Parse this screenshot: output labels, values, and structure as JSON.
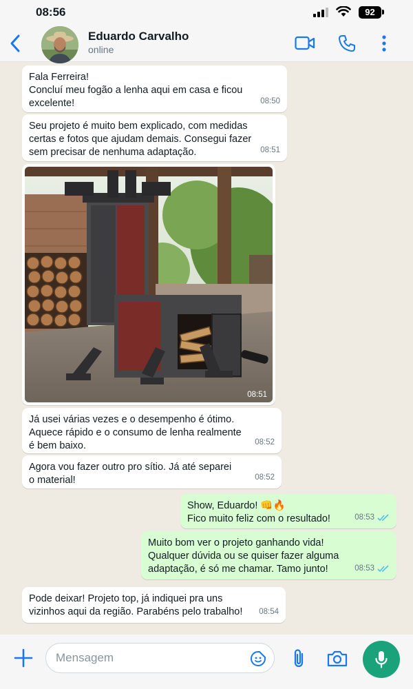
{
  "status_bar": {
    "time": "08:56",
    "battery": "92"
  },
  "header": {
    "contact_name": "Eduardo Carvalho",
    "contact_status": "online",
    "icons": [
      "back-arrow-icon",
      "video-call-icon",
      "phone-call-icon",
      "more-options-icon"
    ]
  },
  "messages": [
    {
      "direction": "in",
      "text": "Fala Ferreira!\nConcluí meu fogão a lenha aqui em casa e ficou\nexcelente!",
      "time": "08:50"
    },
    {
      "direction": "in",
      "text": "Seu projeto é muito bem explicado, com medidas\ncertas e fotos que ajudam demais. Consegui fazer\nsem precisar de nenhuma adaptação.",
      "time": "08:51"
    },
    {
      "direction": "in",
      "type": "image",
      "time": "08:51"
    },
    {
      "direction": "in",
      "text": "Já usei várias vezes e o desempenho é ótimo.\nAquece rápido e o consumo de lenha realmente\né bem baixo.",
      "time": "08:52"
    },
    {
      "direction": "in",
      "text": "Agora vou fazer outro pro sítio. Já até separei\no material!",
      "time": "08:52"
    },
    {
      "direction": "out",
      "text": "Show, Eduardo! 👊🔥\nFico muito feliz com o resultado!",
      "time": "08:53",
      "status": "read"
    },
    {
      "direction": "out",
      "text": "Muito bom ver o projeto ganhando vida!\nQualquer dúvida ou se quiser fazer alguma\nadaptação, é só me chamar. Tamo junto!",
      "time": "08:53",
      "status": "read"
    },
    {
      "direction": "in",
      "text": "Pode deixar! Projeto top, já indiquei pra uns\nvizinhos aqui da região. Parabéns pelo trabalho!",
      "time": "08:54"
    }
  ],
  "input": {
    "placeholder": "Mensagem"
  },
  "colors": {
    "accent": "#1aa37a",
    "read_tick": "#53bdeb",
    "outgoing_bubble": "#d9fdd3",
    "chat_bg": "#efeae2",
    "icon_blue": "#1877f2"
  }
}
